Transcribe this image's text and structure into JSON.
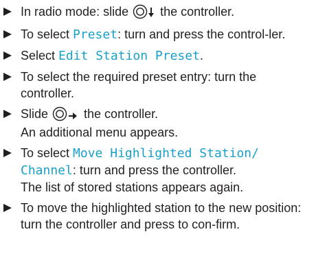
{
  "steps": [
    {
      "pre": "In radio mode: slide ",
      "post": " the controller."
    },
    {
      "pre": "To select ",
      "highlight": "Preset",
      "post": ": turn and press the control-ler."
    },
    {
      "pre": "Select ",
      "highlight": "Edit Station Preset",
      "post": "."
    },
    {
      "text": "To select the required preset entry: turn the controller."
    },
    {
      "pre": "Slide ",
      "post": " the controller.",
      "result": "An additional menu appears."
    },
    {
      "pre": "To select ",
      "highlight": "Move Highlighted Station/ Channel",
      "post": ": turn and press the controller.",
      "result": "The list of stored stations appears again."
    },
    {
      "text": "To move the highlighted station to the new position: turn the controller and press to con-firm."
    }
  ],
  "icons": {
    "controller": "controller-knob-icon",
    "slide_down": "arrow-down-icon",
    "slide_right": "arrow-right-icon",
    "bullet": "triangle-bullet-icon"
  },
  "colors": {
    "text": "#231f20",
    "highlight": "#1aa0c8"
  }
}
